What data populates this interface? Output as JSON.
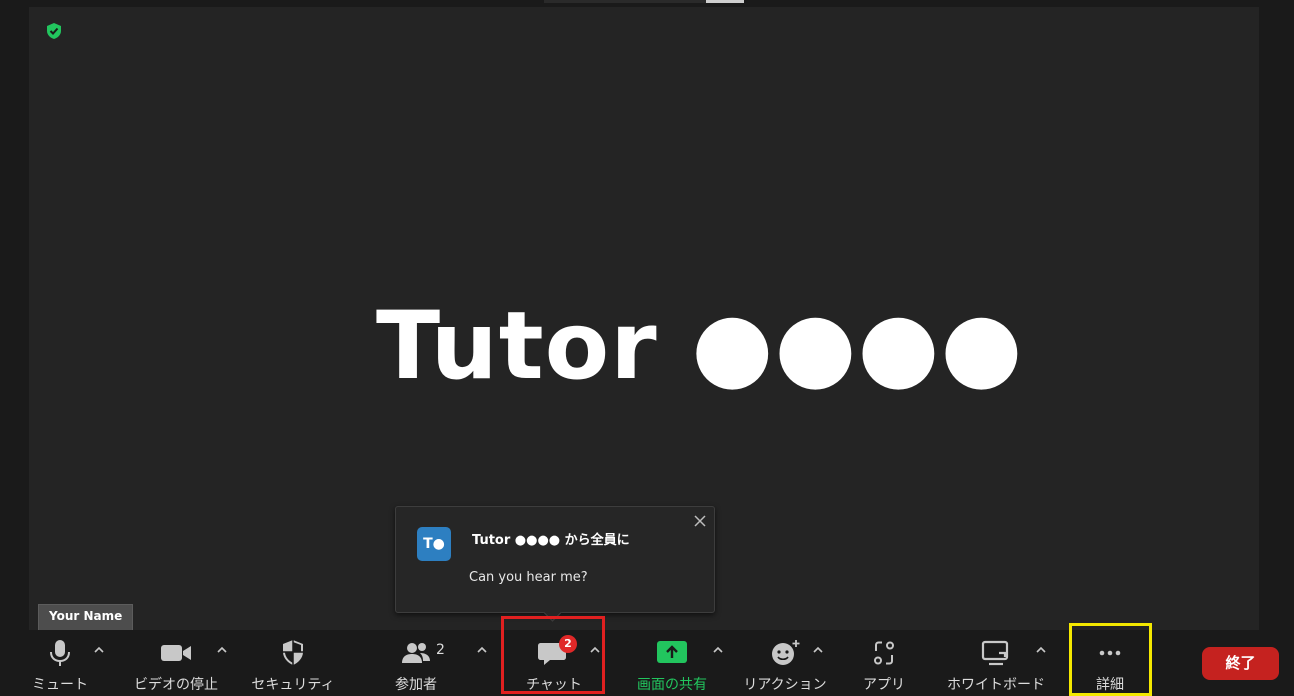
{
  "meeting": {
    "speaker_name": "Tutor ●●●●",
    "self_name_tag": "Your Name"
  },
  "chat_popup": {
    "avatar_initials": "T●",
    "sender_line": "Tutor ●●●● から全員に",
    "message": "Can you hear me?"
  },
  "toolbar": {
    "mute_label": "ミュート",
    "video_label": "ビデオの停止",
    "security_label": "セキュリティ",
    "participants_label": "参加者",
    "participants_count": "2",
    "chat_label": "チャット",
    "chat_badge": "2",
    "share_label": "画面の共有",
    "reactions_label": "リアクション",
    "apps_label": "アプリ",
    "whiteboard_label": "ホワイトボード",
    "more_label": "詳細",
    "end_label": "終了"
  },
  "colors": {
    "share_green": "#22c55e",
    "end_red": "#c5221f",
    "badge_red": "#e02828",
    "highlight_red": "#e02020",
    "highlight_yellow": "#f4e800",
    "encryption_green": "#22c55e",
    "avatar_blue": "#2d7fc1"
  }
}
